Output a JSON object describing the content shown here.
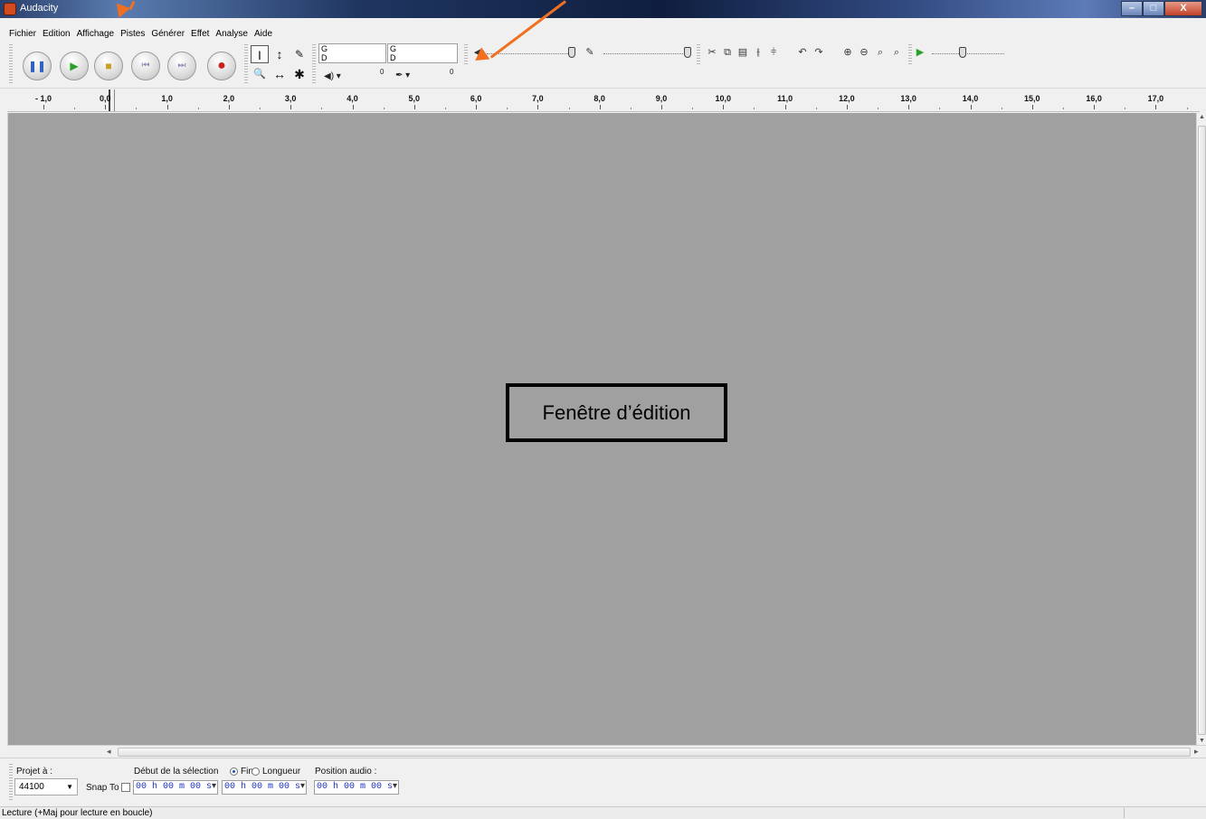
{
  "window": {
    "title": "Audacity",
    "controls": {
      "minimize": "–",
      "maximize": "□",
      "close": "X"
    }
  },
  "menu": [
    "Fichier",
    "Edition",
    "Affichage",
    "Pistes",
    "Générer",
    "Effet",
    "Analyse",
    "Aide"
  ],
  "transport": [
    {
      "name": "pause-button",
      "icon": "pause-icon",
      "glyph": "❚❚",
      "color": "#3060c0"
    },
    {
      "name": "play-button",
      "icon": "play-icon",
      "glyph": "▶",
      "color": "#2aa02a"
    },
    {
      "name": "stop-button",
      "icon": "stop-icon",
      "glyph": "■",
      "color": "#c8a020"
    },
    {
      "name": "skip-start-button",
      "icon": "skip-start-icon",
      "glyph": "⏮",
      "color": "#8a8ab8"
    },
    {
      "name": "skip-end-button",
      "icon": "skip-end-icon",
      "glyph": "⏭",
      "color": "#8a8ab8"
    },
    {
      "name": "record-button",
      "icon": "record-icon",
      "glyph": "●",
      "color": "#c82020"
    }
  ],
  "tools": [
    "I",
    "↕",
    "✎",
    "🔍",
    "↔",
    "✱"
  ],
  "meters": {
    "left_label": "G",
    "right_label": "D",
    "zero": "0"
  },
  "ruler": {
    "labels": [
      "- 1,0",
      "0,0",
      "1,0",
      "2,0",
      "3,0",
      "4,0",
      "5,0",
      "6,0",
      "7,0",
      "8,0",
      "9,0",
      "10,0",
      "11,0",
      "12,0",
      "13,0",
      "14,0",
      "15,0",
      "16,0",
      "17,0"
    ]
  },
  "editor": {
    "annotation": "Fenêtre d’édition"
  },
  "selection_toolbar": {
    "project_rate_label": "Projet à :",
    "project_rate_value": "44100",
    "snap_to_label": "Snap To",
    "selection_start_label": "Début de la sélection",
    "end_label": "Fin",
    "length_label": "Longueur",
    "audio_position_label": "Position audio :",
    "time_start": "00 h 00 m 00 s",
    "time_end": "00 h 00 m 00 s",
    "time_position": "00 h 00 m 00 s"
  },
  "status": {
    "text": "Lecture (+Maj pour lecture en boucle)"
  },
  "colors": {
    "editor_bg": "#a0a0a0",
    "annotation_arrows": "#f07020"
  }
}
